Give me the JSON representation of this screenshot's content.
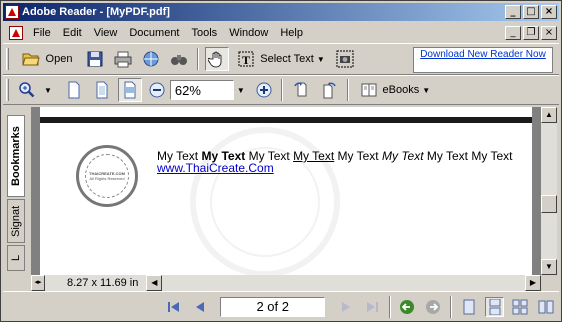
{
  "window": {
    "title": "Adobe Reader - [MyPDF.pdf]"
  },
  "menu": [
    "File",
    "Edit",
    "View",
    "Document",
    "Tools",
    "Window",
    "Help"
  ],
  "toolbar1": {
    "open_label": "Open",
    "select_text_label": "Select Text",
    "ad_text": "Download New Reader Now"
  },
  "toolbar2": {
    "zoom_value": "62%",
    "ebooks_label": "eBooks"
  },
  "side_tabs": [
    "Bookmarks",
    "Signat",
    "L"
  ],
  "document": {
    "line1_segments": [
      "My Text ",
      "My Text",
      " My Text ",
      "My Text",
      " My Text ",
      "My Text",
      " My Text My Text"
    ],
    "link": "www.ThaiCreate.Com",
    "stamp_line1": "THAICREATE.COM",
    "stamp_line2": "All Rights Reserved"
  },
  "status": {
    "page_size": "8.27 x 11.69 in",
    "page_indicator": "2 of 2"
  },
  "colors": {
    "title_start": "#0a246a",
    "title_end": "#a6caf0",
    "link": "#0000cc",
    "nav_green": "#3a8a2a"
  }
}
